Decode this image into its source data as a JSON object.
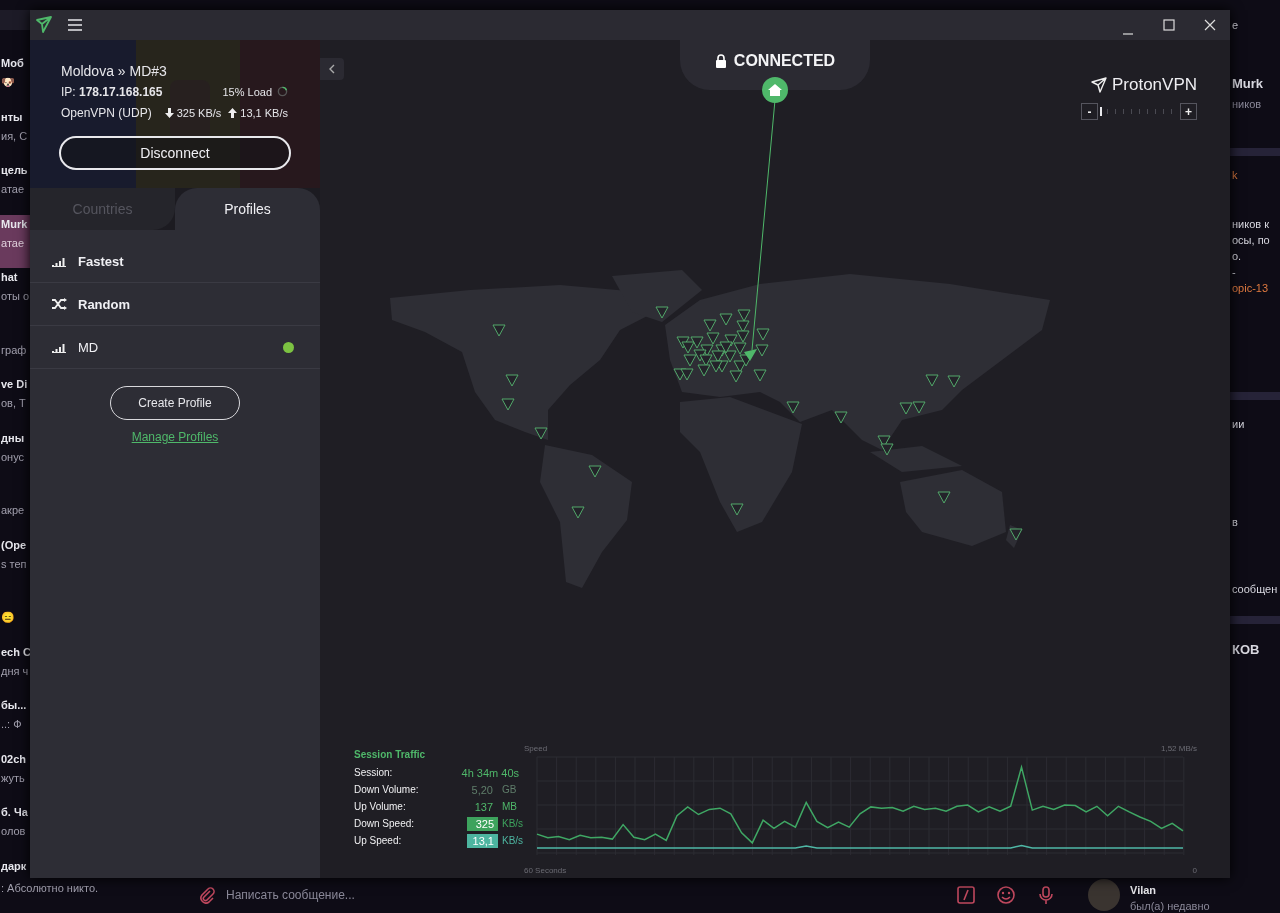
{
  "background_app": {
    "chats": [
      {
        "title": "Моб",
        "preview": "🐶",
        "selected": false
      },
      {
        "title": "нты",
        "preview": "ия, С",
        "selected": false
      },
      {
        "title": "цель",
        "preview": "атае",
        "selected": false
      },
      {
        "title": "Murk",
        "preview": "атае",
        "selected": true
      },
      {
        "title": "hat",
        "preview": "оты о",
        "selected": false
      },
      {
        "preview": "граф",
        "selected": false
      },
      {
        "title": "ve Di",
        "preview": "ов, Т",
        "selected": false
      },
      {
        "title": "дны",
        "preview": "онус",
        "selected": false
      },
      {
        "preview": "акре",
        "selected": false
      },
      {
        "title": "(Ope",
        "preview": "s теп",
        "selected": false
      },
      {
        "preview": "😑",
        "selected": false
      },
      {
        "title": "ech C",
        "preview": "дня ч",
        "selected": false
      },
      {
        "title": "бы...",
        "preview": "..: Ф",
        "selected": false
      },
      {
        "title": "02ch",
        "preview": "жуть",
        "selected": false
      },
      {
        "title": "б. Ча",
        "preview": "олов",
        "selected": false
      },
      {
        "title": "дарк",
        "preview": ": Абсолютно никто.",
        "selected": false
      }
    ],
    "info_panel": [
      {
        "text": "e",
        "kind": "text"
      },
      {
        "text": "Murk",
        "kind": "title"
      },
      {
        "text": "ников",
        "kind": "muted"
      },
      {
        "text": "k",
        "kind": "link"
      },
      {
        "text": "ников к",
        "kind": "text"
      },
      {
        "text": "осы, по",
        "kind": "text"
      },
      {
        "text": "о.",
        "kind": "text"
      },
      {
        "text": "-",
        "kind": "text"
      },
      {
        "text": "opic-13",
        "kind": "link"
      },
      {
        "text": "ии",
        "kind": "text"
      },
      {
        "text": "в",
        "kind": "text"
      },
      {
        "text": "сообщен",
        "kind": "text"
      },
      {
        "text": "КОВ",
        "kind": "title"
      }
    ],
    "composer": {
      "placeholder": "Написать сообщение..."
    },
    "contact": {
      "name": "Vilan",
      "status": "был(а) недавно"
    }
  },
  "vpn": {
    "connection": {
      "server": "Moldova » MD#3",
      "ip": "IP: **178.17.168.165**",
      "load": "15% Load",
      "protocol": "OpenVPN (UDP)",
      "download": "325 KB/s",
      "upload": "13,1 KB/s"
    },
    "disconnect_button": "Disconnect",
    "tabs": [
      {
        "label": "Countries",
        "selected": false
      },
      {
        "label": "Profiles",
        "selected": true
      }
    ],
    "profiles": [
      {
        "name": "Fastest",
        "kind": "fastest",
        "connected": false
      },
      {
        "name": "Random",
        "kind": "random",
        "connected": false
      },
      {
        "name": "MD",
        "kind": "custom",
        "connected": true
      }
    ],
    "create_profile_button": "Create Profile",
    "manage_profiles_link": "Manage Profiles",
    "status": "CONNECTED",
    "logo": "ProtonVPN",
    "zoom": {
      "minus": "-",
      "plus": "+",
      "level": 0
    },
    "traffic": {
      "title": "Session Traffic",
      "rows": [
        {
          "label": "Session:",
          "value": "4h 34m 40s",
          "color": "#4fb86a",
          "kind": "text"
        },
        {
          "label": "Down Volume:",
          "value": "5,20",
          "unit": "GB",
          "color": "#5f7d6a",
          "kind": "text"
        },
        {
          "label": "Up Volume:",
          "value": "137",
          "unit": "MB",
          "color": "#4fb86a",
          "kind": "text"
        },
        {
          "label": "Down Speed:",
          "value": "325",
          "unit": "KB/s",
          "color": "#3da35d",
          "kind": "badge"
        },
        {
          "label": "Up Speed:",
          "value": "13,1",
          "unit": "KB/s",
          "color": "#4db5a0",
          "kind": "badge"
        }
      ],
      "speed_graph": {
        "title": "Speed",
        "max_label": "1,52  MB/s",
        "start_label": "60 Seconds",
        "end_label": "0"
      }
    }
  }
}
